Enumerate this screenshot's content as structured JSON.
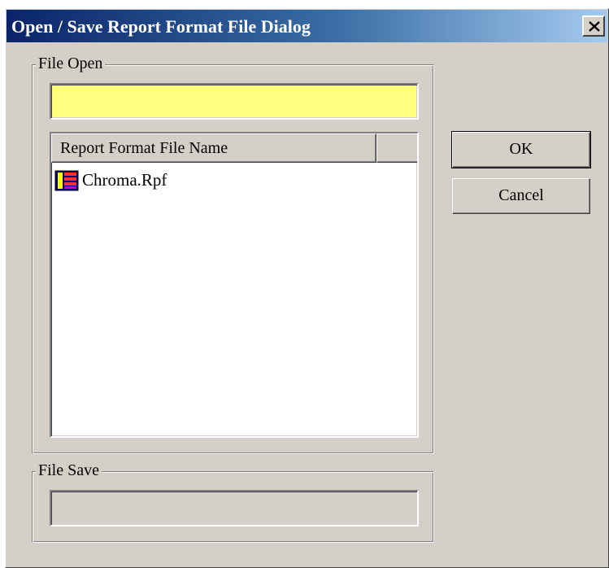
{
  "window": {
    "title": "Open / Save Report Format File Dialog",
    "close_icon": "close-icon"
  },
  "file_open": {
    "legend": "File Open",
    "input_value": "",
    "list": {
      "columns": [
        "Report Format File Name",
        ""
      ],
      "items": [
        {
          "name": "Chroma.Rpf",
          "icon": "report-file-icon"
        }
      ]
    }
  },
  "file_save": {
    "legend": "File Save",
    "input_value": ""
  },
  "buttons": {
    "ok_label": "OK",
    "cancel_label": "Cancel"
  },
  "colors": {
    "dialog_bg": "#d4d0c8",
    "titlebar_start": "#0a246a",
    "titlebar_end": "#a6caf0",
    "open_input_bg": "#ffff80",
    "list_bg": "#ffffff"
  }
}
